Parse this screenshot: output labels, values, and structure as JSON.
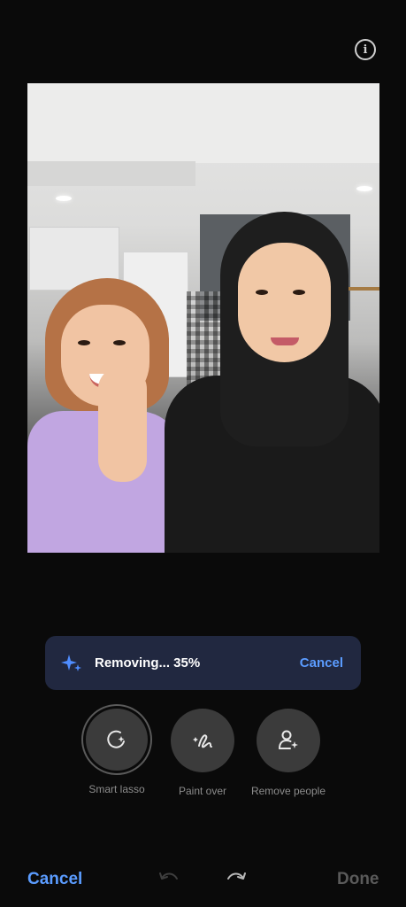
{
  "header": {
    "info_label": "i"
  },
  "progress": {
    "text": "Removing... 35%",
    "percent": 35,
    "cancel_label": "Cancel",
    "icon": "sparkle-icon"
  },
  "tools": [
    {
      "label": "Smart lasso",
      "icon": "smart-lasso-icon",
      "selected": true
    },
    {
      "label": "Paint over",
      "icon": "paint-over-icon",
      "selected": false
    },
    {
      "label": "Remove people",
      "icon": "remove-people-icon",
      "selected": false
    }
  ],
  "bottom_bar": {
    "cancel_label": "Cancel",
    "done_label": "Done"
  },
  "colors": {
    "accent": "#5b9cff",
    "toast_bg": "#212840",
    "disabled": "#5a5a5a"
  }
}
